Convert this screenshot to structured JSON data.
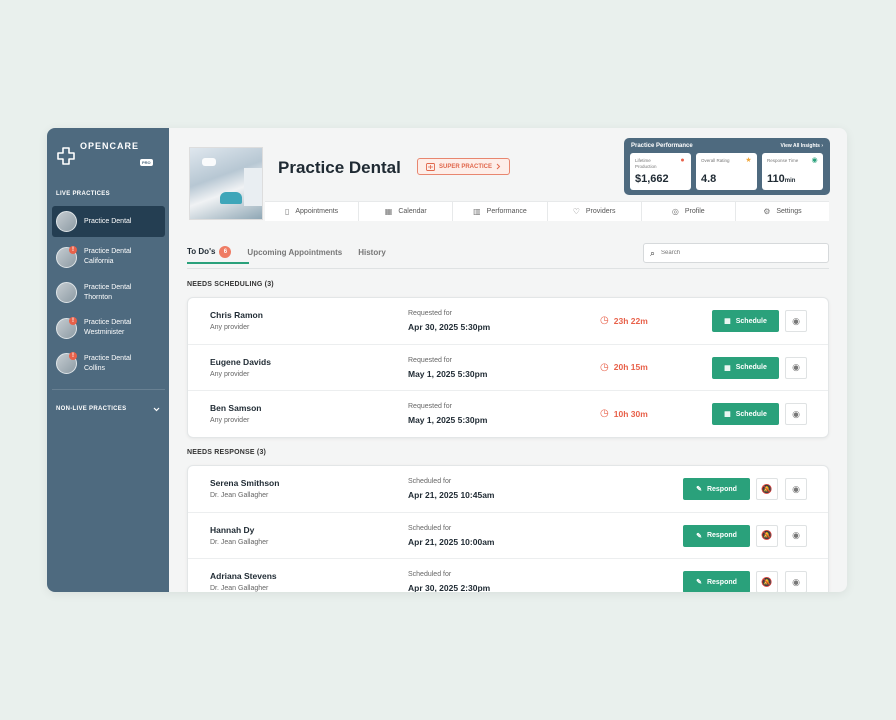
{
  "sidebar": {
    "logo_text": "OPENCARE",
    "logo_badge": "PRO",
    "live_label": "LIVE PRACTICES",
    "items": [
      {
        "line1": "Practice Dental",
        "line2": "",
        "alert": false,
        "active": true
      },
      {
        "line1": "Practice Dental",
        "line2": "California",
        "alert": true,
        "active": false
      },
      {
        "line1": "Practice Dental",
        "line2": "Thornton",
        "alert": false,
        "active": false
      },
      {
        "line1": "Practice  Dental",
        "line2": "Westminister",
        "alert": true,
        "active": false
      },
      {
        "line1": "Practice Dental",
        "line2": "Collins",
        "alert": true,
        "active": false
      }
    ],
    "nonlive_label": "NON-LIVE PRACTICES"
  },
  "header": {
    "title": "Practice Dental",
    "badge": "SUPER PRACTICE"
  },
  "performance": {
    "title": "Practice Performance",
    "link": "View All Insights",
    "cards": [
      {
        "label": "Lifetime Production",
        "value": "$1,662",
        "unit": "",
        "icon": "person-icon",
        "icon_color": "#e8614a"
      },
      {
        "label": "Overall Rating",
        "value": "4.8",
        "unit": "",
        "icon": "star-icon",
        "icon_color": "#f0a73c"
      },
      {
        "label": "Response Time",
        "value": "110",
        "unit": "min",
        "icon": "clock-icon",
        "icon_color": "#2aa17b"
      }
    ]
  },
  "nav_tabs": [
    {
      "label": "Appointments",
      "icon": "clipboard-icon"
    },
    {
      "label": "Calendar",
      "icon": "calendar-icon"
    },
    {
      "label": "Performance",
      "icon": "bar-chart-icon"
    },
    {
      "label": "Providers",
      "icon": "tooth-icon"
    },
    {
      "label": "Profile",
      "icon": "user-circle-icon"
    },
    {
      "label": "Settings",
      "icon": "gear-icon"
    }
  ],
  "subtabs": {
    "todos": "To Do's",
    "todos_count": "6",
    "upcoming": "Upcoming Appointments",
    "history": "History"
  },
  "search": {
    "placeholder": "Search"
  },
  "scheduling": {
    "label": "NEEDS SCHEDULING (3)",
    "button": "Schedule",
    "rows": [
      {
        "name": "Chris Ramon",
        "sub": "Any provider",
        "req_label": "Requested for",
        "date": "Apr 30, 2025 5:30pm",
        "timer": "23h 22m"
      },
      {
        "name": "Eugene Davids",
        "sub": "Any provider",
        "req_label": "Requested for",
        "date": "May 1, 2025 5:30pm",
        "timer": "20h 15m"
      },
      {
        "name": "Ben Samson",
        "sub": "Any provider",
        "req_label": "Requested for",
        "date": "May 1, 2025 5:30pm",
        "timer": "10h 30m"
      }
    ]
  },
  "response": {
    "label": "NEEDS RESPONSE (3)",
    "button": "Respond",
    "rows": [
      {
        "name": "Serena Smithson",
        "sub": "Dr. Jean Gallagher",
        "req_label": "Scheduled for",
        "date": "Apr 21, 2025 10:45am"
      },
      {
        "name": "Hannah Dy",
        "sub": "Dr. Jean Gallagher",
        "req_label": "Scheduled for",
        "date": "Apr 21, 2025 10:00am"
      },
      {
        "name": "Adriana Stevens",
        "sub": "Dr. Jean Gallagher",
        "req_label": "Scheduled for",
        "date": "Apr 30, 2025 2:30pm"
      }
    ]
  }
}
